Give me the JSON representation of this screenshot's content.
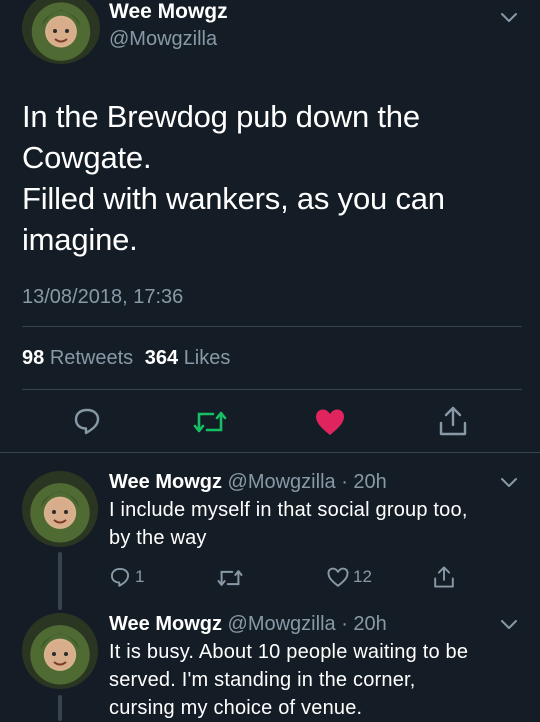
{
  "main_tweet": {
    "display_name": "Wee Mowgz",
    "handle": "@Mowgzilla",
    "text_lines": [
      "In the Brewdog pub down the",
      "Cowgate.",
      "Filled with wankers, as you can",
      "imagine."
    ],
    "timestamp": "13/08/2018, 17:36",
    "retweets_count": "98",
    "retweets_label": "Retweets",
    "likes_count": "364",
    "likes_label": "Likes",
    "liked": true,
    "colors": {
      "retweet": "#17bf63",
      "like": "#e0245e",
      "muted": "#8899a6"
    }
  },
  "replies": [
    {
      "display_name": "Wee Mowgz",
      "handle_time": "@Mowgzilla · 20h",
      "text_lines": [
        "I include myself in that social group too,",
        "by the way"
      ],
      "reply_count": "1",
      "like_count": "12"
    },
    {
      "display_name": "Wee Mowgz",
      "handle_time": "@Mowgzilla · 20h",
      "text_lines": [
        "It is busy. About 10 people waiting to be",
        "served. I'm standing in the corner,",
        "cursing my choice of venue."
      ]
    }
  ]
}
